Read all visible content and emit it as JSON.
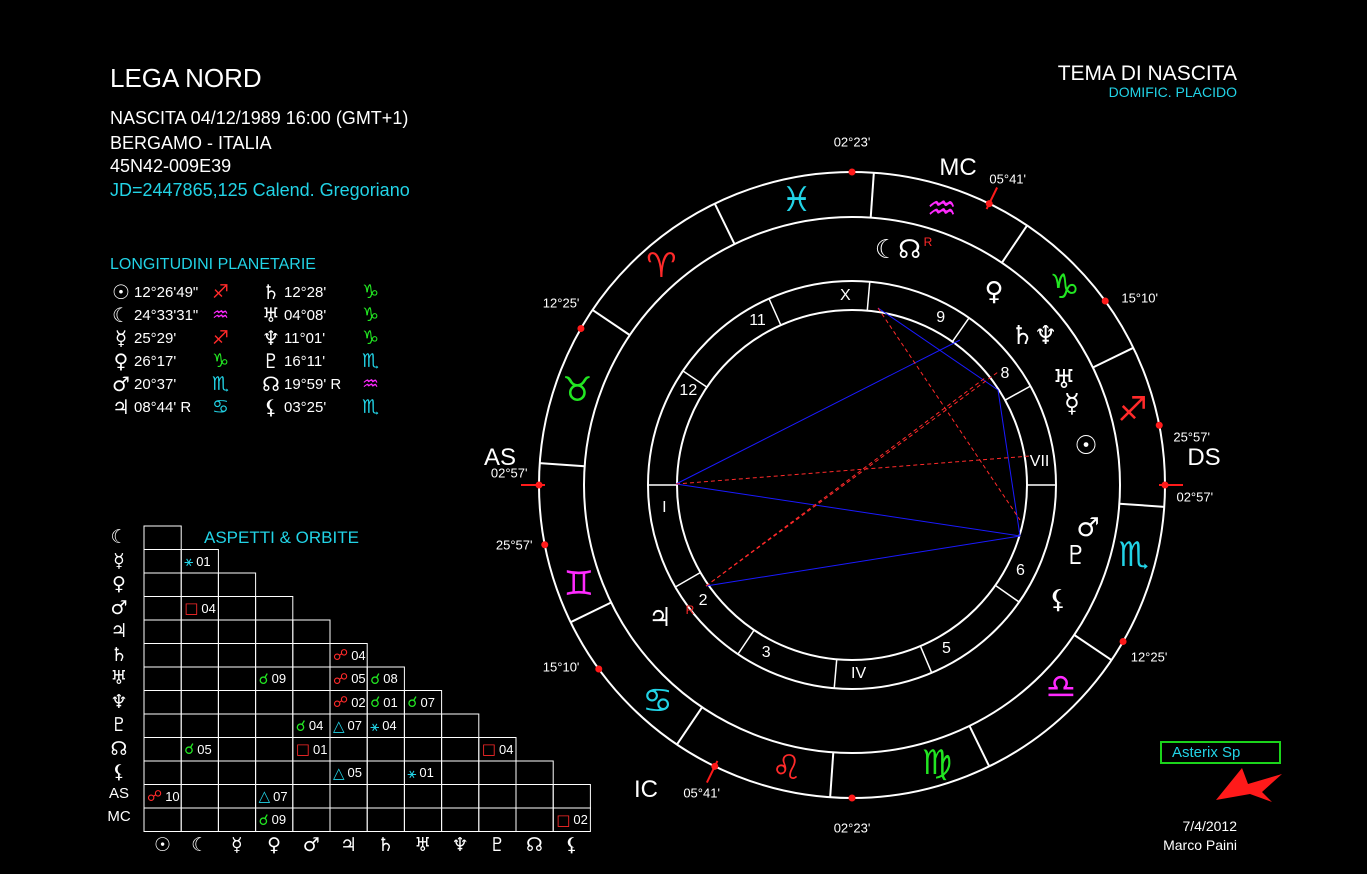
{
  "header": {
    "title": "LEGA NORD",
    "birth": "NASCITA 04/12/1989 16:00 (GMT+1)",
    "place": "BERGAMO - ITALIA",
    "coords": "45N42-009E39",
    "jd": "JD=2447865,125  Calend. Gregoriano",
    "chart_title": "TEMA DI NASCITA",
    "house_system": "DOMIFIC. PLACIDO"
  },
  "longitudes": {
    "title": "LONGITUDINI PLANETARIE",
    "left": [
      {
        "glyph": "☉",
        "deg": "12°26'49\"",
        "sign": "♐",
        "color": "#ff2a2a"
      },
      {
        "glyph": "☾",
        "deg": "24°33'31\"",
        "sign": "♒",
        "color": "#ff2aff"
      },
      {
        "glyph": "☿",
        "deg": "25°29'",
        "sign": "♐",
        "color": "#ff2a2a"
      },
      {
        "glyph": "♀",
        "deg": "26°17'",
        "sign": "♑",
        "color": "#22e622"
      },
      {
        "glyph": "♂",
        "deg": "20°37'",
        "sign": "♏",
        "color": "#22d3e6"
      },
      {
        "glyph": "♃",
        "deg": "08°44' R",
        "sign": "♋",
        "color": "#22d3e6"
      }
    ],
    "right": [
      {
        "glyph": "♄",
        "deg": "12°28'",
        "sign": "♑",
        "color": "#22e622"
      },
      {
        "glyph": "♅",
        "deg": "04°08'",
        "sign": "♑",
        "color": "#22e622"
      },
      {
        "glyph": "♆",
        "deg": "11°01'",
        "sign": "♑",
        "color": "#22e622"
      },
      {
        "glyph": "♇",
        "deg": "16°11'",
        "sign": "♏",
        "color": "#22d3e6"
      },
      {
        "glyph": "☊",
        "deg": "19°59' R",
        "sign": "♒",
        "color": "#ff2aff"
      },
      {
        "glyph": "⚸",
        "deg": "03°25'",
        "sign": "♏",
        "color": "#22d3e6"
      }
    ]
  },
  "aspects": {
    "title": "ASPETTI  &  ORBITE",
    "row_labels": [
      "☾",
      "☿",
      "♀",
      "♂",
      "♃",
      "♄",
      "♅",
      "♆",
      "♇",
      "☊",
      "⚸",
      "AS",
      "MC"
    ],
    "col_labels": [
      "☉",
      "☾",
      "☿",
      "♀",
      "♂",
      "♃",
      "♄",
      "♅",
      "♆",
      "♇",
      "☊",
      "⚸"
    ],
    "cells": [
      {
        "r": 1,
        "c": 1,
        "g": "⚹",
        "v": "01",
        "color": "#22d3e6"
      },
      {
        "r": 3,
        "c": 1,
        "g": "□",
        "v": "04",
        "color": "#ff2a2a"
      },
      {
        "r": 5,
        "c": 5,
        "g": "☍",
        "v": "04",
        "color": "#ff2a2a"
      },
      {
        "r": 6,
        "c": 3,
        "g": "☌",
        "v": "09",
        "color": "#22e622"
      },
      {
        "r": 6,
        "c": 5,
        "g": "☍",
        "v": "05",
        "color": "#ff2a2a"
      },
      {
        "r": 6,
        "c": 6,
        "g": "☌",
        "v": "08",
        "color": "#22e622"
      },
      {
        "r": 7,
        "c": 5,
        "g": "☍",
        "v": "02",
        "color": "#ff2a2a"
      },
      {
        "r": 7,
        "c": 6,
        "g": "☌",
        "v": "01",
        "color": "#22e622"
      },
      {
        "r": 7,
        "c": 7,
        "g": "☌",
        "v": "07",
        "color": "#22e622"
      },
      {
        "r": 8,
        "c": 4,
        "g": "☌",
        "v": "04",
        "color": "#22e622"
      },
      {
        "r": 8,
        "c": 5,
        "g": "△",
        "v": "07",
        "color": "#22d3e6"
      },
      {
        "r": 8,
        "c": 6,
        "g": "⚹",
        "v": "04",
        "color": "#22d3e6"
      },
      {
        "r": 9,
        "c": 1,
        "g": "☌",
        "v": "05",
        "color": "#22e622"
      },
      {
        "r": 9,
        "c": 4,
        "g": "□",
        "v": "01",
        "color": "#ff2a2a"
      },
      {
        "r": 9,
        "c": 9,
        "g": "□",
        "v": "04",
        "color": "#ff2a2a"
      },
      {
        "r": 10,
        "c": 5,
        "g": "△",
        "v": "05",
        "color": "#22d3e6"
      },
      {
        "r": 10,
        "c": 7,
        "g": "⚹",
        "v": "01",
        "color": "#22d3e6"
      },
      {
        "r": 11,
        "c": 0,
        "g": "☍",
        "v": "10",
        "color": "#ff2a2a"
      },
      {
        "r": 11,
        "c": 3,
        "g": "△",
        "v": "07",
        "color": "#22d3e6"
      },
      {
        "r": 12,
        "c": 3,
        "g": "☌",
        "v": "09",
        "color": "#22e622"
      },
      {
        "r": 12,
        "c": 11,
        "g": "□",
        "v": "02",
        "color": "#ff2a2a"
      }
    ]
  },
  "wheel": {
    "axes": {
      "as": "AS",
      "ds": "DS",
      "mc": "MC",
      "ic": "IC"
    },
    "cusp_labels": [
      "02°23'",
      "05°41'",
      "15°10'",
      "25°57'",
      "02°57'",
      "12°25'",
      "02°23'",
      "05°41'",
      "15°10'",
      "25°57'",
      "02°57'",
      "12°25'"
    ],
    "house_numbers": [
      "I",
      "2",
      "3",
      "IV",
      "5",
      "6",
      "VII",
      "8",
      "9",
      "X",
      "11",
      "12"
    ],
    "signs": [
      {
        "glyph": "♓",
        "color": "#22d3e6"
      },
      {
        "glyph": "♒",
        "color": "#ff2aff"
      },
      {
        "glyph": "♑",
        "color": "#22e622"
      },
      {
        "glyph": "♐",
        "color": "#ff2a2a"
      },
      {
        "glyph": "♏",
        "color": "#22d3e6"
      },
      {
        "glyph": "♎",
        "color": "#ff2aff"
      },
      {
        "glyph": "♍",
        "color": "#22e622"
      },
      {
        "glyph": "♌",
        "color": "#ff2a2a"
      },
      {
        "glyph": "♋",
        "color": "#22d3e6"
      },
      {
        "glyph": "♊",
        "color": "#ff2aff"
      },
      {
        "glyph": "♉",
        "color": "#22e622"
      },
      {
        "glyph": "♈",
        "color": "#ff2a2a"
      }
    ],
    "planets": [
      {
        "glyph": "☾☊",
        "retro": "R"
      },
      {
        "glyph": "♀",
        "retro": ""
      },
      {
        "glyph": "♄♆",
        "retro": ""
      },
      {
        "glyph": "♅",
        "retro": ""
      },
      {
        "glyph": "☿",
        "retro": ""
      },
      {
        "glyph": "☉",
        "retro": ""
      },
      {
        "glyph": "♂",
        "retro": ""
      },
      {
        "glyph": "♇",
        "retro": ""
      },
      {
        "glyph": "⚸",
        "retro": ""
      },
      {
        "glyph": "♃",
        "retro": "R"
      }
    ]
  },
  "footer": {
    "badge": "Asterix Sp",
    "date": "7/4/2012",
    "author": "Marco Paini"
  }
}
